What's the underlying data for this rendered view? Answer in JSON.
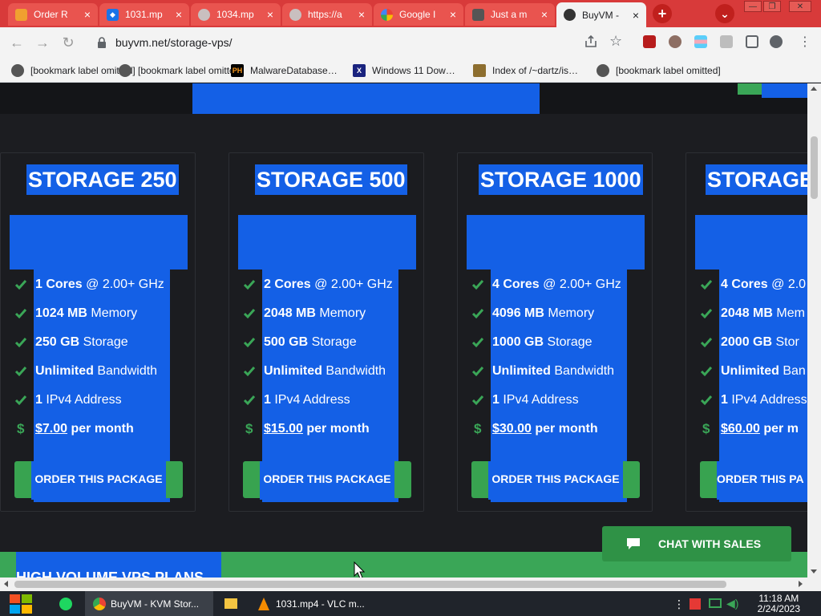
{
  "browser": {
    "tabs": [
      {
        "title": "Order R",
        "favicon": "buyvm-favicon",
        "active": false
      },
      {
        "title": "1031.mp",
        "favicon": "dropbox-icon",
        "active": false
      },
      {
        "title": "1034.mp",
        "favicon": "globe-icon",
        "active": false
      },
      {
        "title": "https://a",
        "favicon": "globe-icon",
        "active": false
      },
      {
        "title": "Google I",
        "favicon": "google-icon",
        "active": false
      },
      {
        "title": "Just a m",
        "favicon": "site-icon",
        "active": false
      },
      {
        "title": "BuyVM -",
        "favicon": "horse-icon",
        "active": true
      }
    ],
    "new_tab_symbol": "+",
    "tab_search_symbol": "⌄",
    "url": "buyvm.net/storage-vps/",
    "bookmarks": [
      {
        "label": "[bookmark label omitted]",
        "icon": "bookmark-icon"
      },
      {
        "label": "[bookmark label omitted]",
        "icon": "bookmark-icon"
      },
      {
        "label": "MalwareDatabase…",
        "icon": "ph-icon",
        "icon_text": "PH"
      },
      {
        "label": "Windows 11 Dow…",
        "icon": "x-icon",
        "icon_text": "X"
      },
      {
        "label": "Index of /~dartz/is…",
        "icon": "folder-icon"
      },
      {
        "label": "[bookmark label omitted]",
        "icon": "bookmark-icon"
      }
    ]
  },
  "page": {
    "plans": [
      {
        "name": "STORAGE 250",
        "features": [
          {
            "bold": "1 Cores",
            "rest": " @ 2.00+ GHz"
          },
          {
            "bold": "1024 MB",
            "rest": " Memory"
          },
          {
            "bold": "250 GB",
            "rest": " Storage"
          },
          {
            "bold": "Unlimited",
            "rest": " Bandwidth"
          },
          {
            "bold": "1",
            "rest": " IPv4 Address"
          }
        ],
        "price": "$7.00",
        "price_suffix": " per month",
        "button": "ORDER THIS PACKAGE"
      },
      {
        "name": "STORAGE 500",
        "features": [
          {
            "bold": "2 Cores",
            "rest": " @ 2.00+ GHz"
          },
          {
            "bold": "2048 MB",
            "rest": " Memory"
          },
          {
            "bold": "500 GB",
            "rest": " Storage"
          },
          {
            "bold": "Unlimited",
            "rest": " Bandwidth"
          },
          {
            "bold": "1",
            "rest": " IPv4 Address"
          }
        ],
        "price": "$15.00",
        "price_suffix": " per month",
        "button": "ORDER THIS PACKAGE"
      },
      {
        "name": "STORAGE 1000",
        "features": [
          {
            "bold": "4 Cores",
            "rest": " @ 2.00+ GHz"
          },
          {
            "bold": "4096 MB",
            "rest": " Memory"
          },
          {
            "bold": "1000 GB",
            "rest": " Storage"
          },
          {
            "bold": "Unlimited",
            "rest": " Bandwidth"
          },
          {
            "bold": "1",
            "rest": " IPv4 Address"
          }
        ],
        "price": "$30.00",
        "price_suffix": " per month",
        "button": "ORDER THIS PACKAGE"
      },
      {
        "name": "STORAGE",
        "features": [
          {
            "bold": "4 Cores",
            "rest": " @ 2.0"
          },
          {
            "bold": "2048 MB",
            "rest": " Mem"
          },
          {
            "bold": "2000 GB",
            "rest": " Stor"
          },
          {
            "bold": "Unlimited",
            "rest": " Ban"
          },
          {
            "bold": "1",
            "rest": " IPv4 Address"
          }
        ],
        "price": "$60.00",
        "price_suffix": " per m",
        "button": "ORDER THIS PA"
      }
    ],
    "dollar_symbol": "$",
    "chat_button": "CHAT WITH SALES",
    "section_heading": "HIGH VOLUME VPS PLANS"
  },
  "taskbar": {
    "items": [
      {
        "label": "BuyVM - KVM Stor...",
        "icon": "chrome-icon",
        "active": true
      },
      {
        "label": "",
        "icon": "file-explorer-icon",
        "active": false
      },
      {
        "label": "1031.mp4 - VLC m...",
        "icon": "vlc-icon",
        "active": false
      }
    ],
    "time": "11:18 AM",
    "date": "2/24/2023"
  },
  "colors": {
    "tabstrip": "#d83a3a",
    "highlight": "#1460e6",
    "green": "#3aa657",
    "page_bg": "#1c1d21"
  }
}
